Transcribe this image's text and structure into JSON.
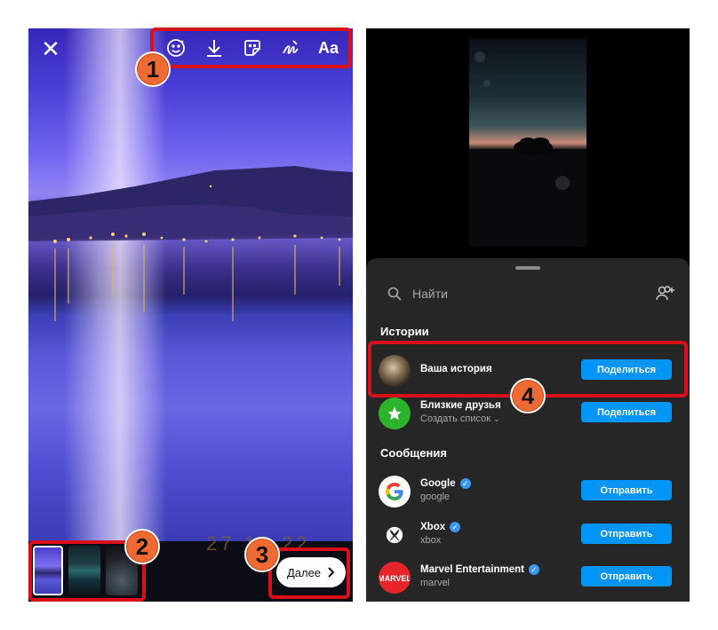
{
  "editor": {
    "close_icon": "close-icon",
    "tools": [
      {
        "name": "effects-smiley-icon"
      },
      {
        "name": "download-icon"
      },
      {
        "name": "sticker-icon"
      },
      {
        "name": "draw-scribble-icon"
      },
      {
        "name": "text-tool",
        "label": "Aa"
      }
    ],
    "date_stamp": "27 12 22",
    "next_label": "Далее",
    "next_icon": "chevron-right-icon"
  },
  "share_sheet": {
    "search_placeholder": "Найти",
    "stories_title": "Истории",
    "messages_title": "Сообщения",
    "stories": [
      {
        "title": "Ваша история",
        "subtitle": "",
        "button": "Поделиться"
      },
      {
        "title": "Близкие друзья",
        "subtitle": "Создать список",
        "button": "Поделиться"
      }
    ],
    "contacts": [
      {
        "title": "Google",
        "subtitle": "google",
        "verified": true,
        "button": "Отправить"
      },
      {
        "title": "Xbox",
        "subtitle": "xbox",
        "verified": true,
        "button": "Отправить"
      },
      {
        "title": "Marvel Entertainment",
        "subtitle": "marvel",
        "verified": true,
        "button": "Отправить"
      }
    ]
  },
  "annotations": [
    "1",
    "2",
    "3",
    "4"
  ],
  "colors": {
    "highlight": "#d9101a",
    "badge": "#ef6b33",
    "button_blue": "#0095f6",
    "sheet_bg": "#262626",
    "close_friends_green": "#2bb32b"
  }
}
